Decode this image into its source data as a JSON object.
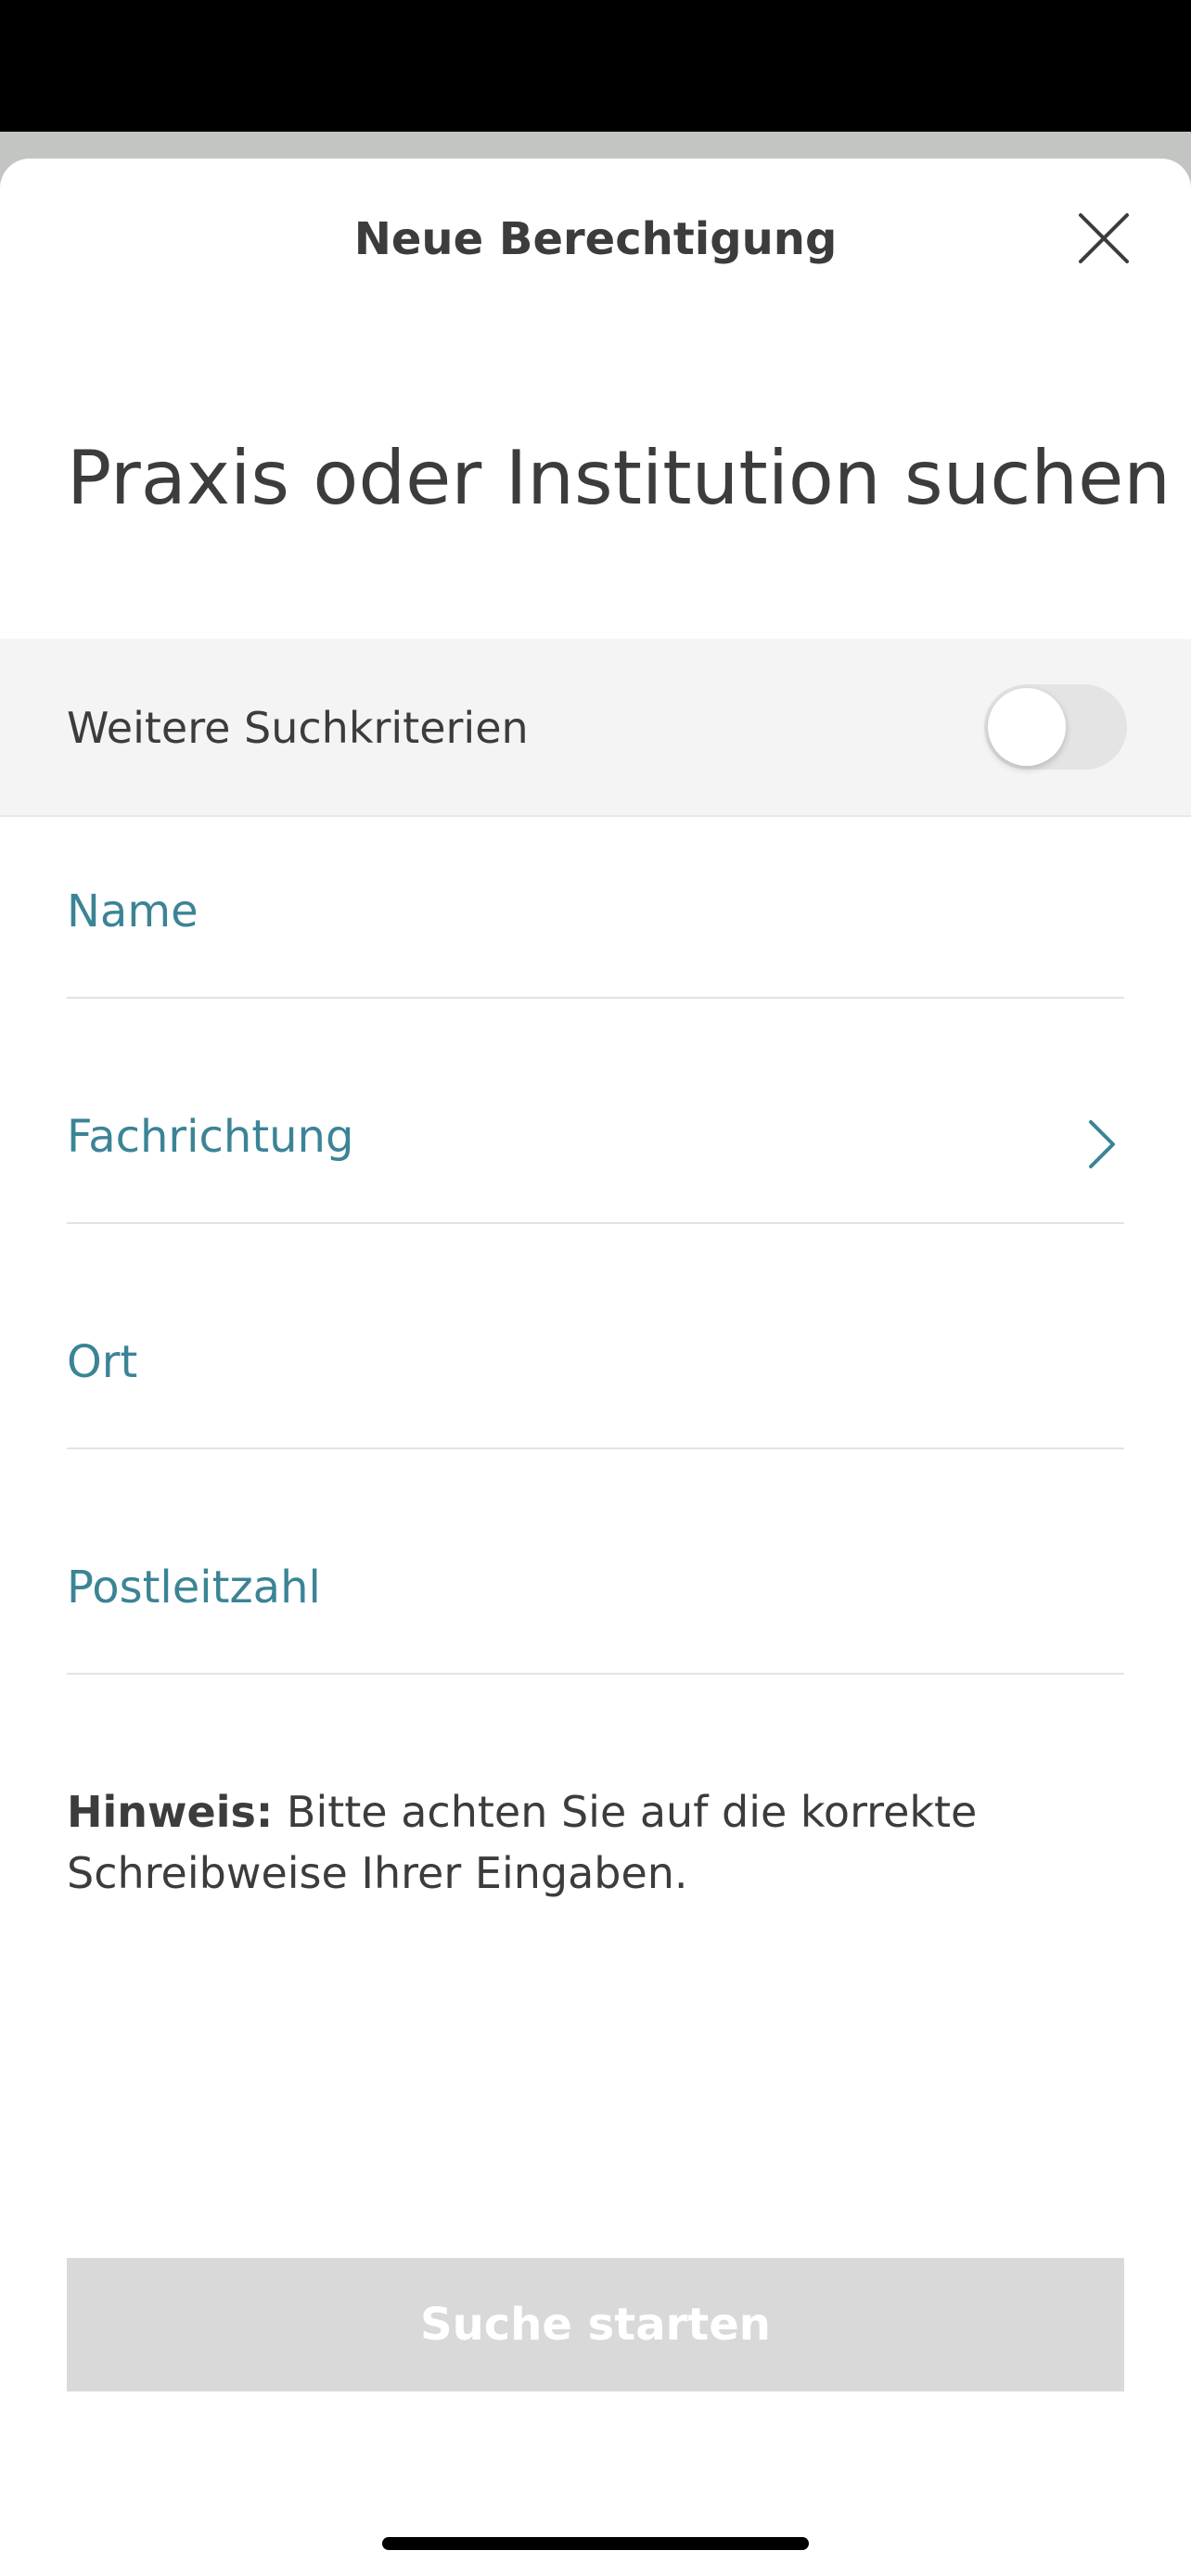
{
  "sheet": {
    "title": "Neue Berechtigung"
  },
  "heading": "Praxis oder Institution suchen",
  "criteria": {
    "label": "Weitere Suchkriterien",
    "enabled": false
  },
  "fields": [
    {
      "label": "Name",
      "value": ""
    },
    {
      "label": "Fachrichtung",
      "value": ""
    },
    {
      "label": "Ort",
      "value": ""
    },
    {
      "label": "Postleitzahl",
      "value": ""
    }
  ],
  "hint": {
    "prefix": "Hinweis:",
    "text": " Bitte achten Sie auf die korrekte Schreibweise Ihrer Eingaben."
  },
  "search_button": {
    "label": "Suche starten"
  },
  "icons": {
    "close": "close-icon",
    "chevron": "chevron-right-icon"
  },
  "colors": {
    "accent": "#3b8496",
    "text": "#3c3c3c",
    "button_disabled": "#d9d9d9"
  }
}
